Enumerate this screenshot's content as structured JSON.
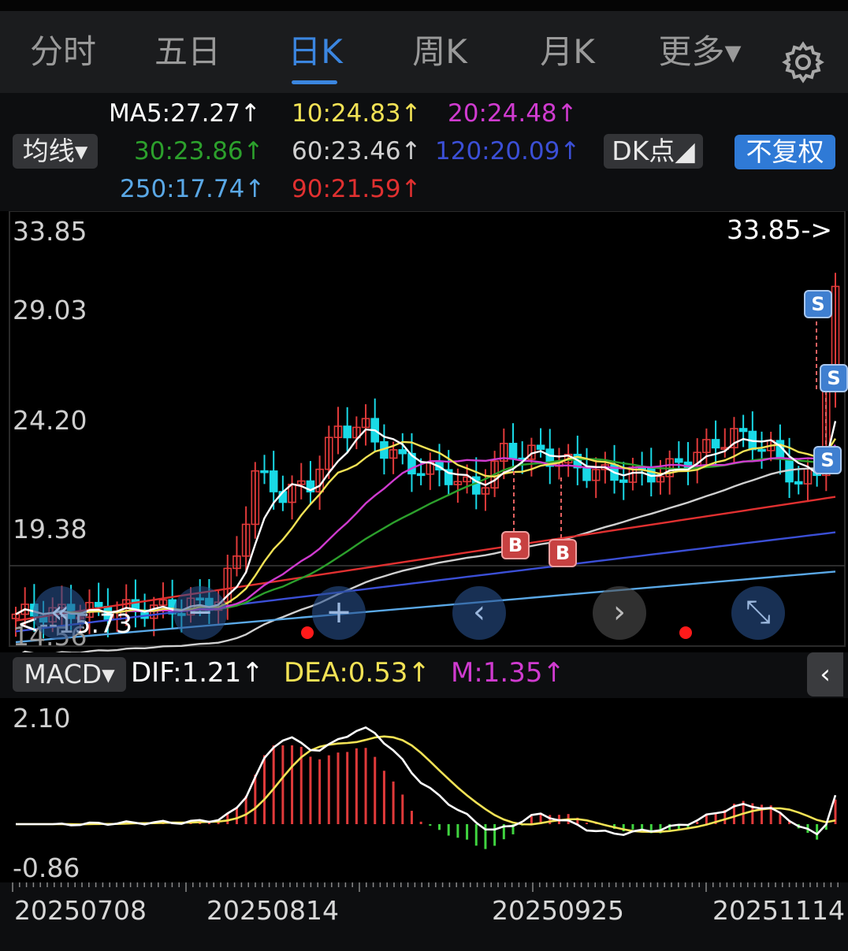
{
  "tabs": [
    {
      "label": "分时",
      "active": false
    },
    {
      "label": "五日",
      "active": false
    },
    {
      "label": "日K",
      "active": true
    },
    {
      "label": "周K",
      "active": false
    },
    {
      "label": "月K",
      "active": false
    },
    {
      "label": "更多▾",
      "active": false
    }
  ],
  "controls": {
    "ma_dropdown": "均线▾",
    "dk_button": "DK点◢",
    "adjust_button": "不复权"
  },
  "ma": [
    {
      "label": "MA5:27.27↑",
      "color": "#ffffff"
    },
    {
      "label": "10:24.83↑",
      "color": "#f2e255"
    },
    {
      "label": "20:24.48↑",
      "color": "#d03bd0"
    },
    {
      "label": "30:23.86↑",
      "color": "#2ca02c"
    },
    {
      "label": "60:23.46↑",
      "color": "#d0d0d0"
    },
    {
      "label": "120:20.09↑",
      "color": "#3b4fd6"
    },
    {
      "label": "250:17.74↑",
      "color": "#5aa8e6"
    },
    {
      "label": "90:21.59↑",
      "color": "#e03030"
    }
  ],
  "price_axis": [
    "33.85",
    "29.03",
    "24.20",
    "19.38",
    "14.56"
  ],
  "high_marker": "33.85->",
  "low_marker": "<--15.73",
  "macd": {
    "selector": "MACD▾",
    "dif": "DIF:1.21↑",
    "dea": "DEA:0.53↑",
    "m": "M:1.35↑",
    "axis_top": "2.10",
    "axis_bottom": "-0.86",
    "collapse": "‹"
  },
  "dates": [
    "20250708",
    "20250814",
    "20250925",
    "20251114"
  ],
  "signals": [
    {
      "label": "S",
      "type": "s"
    },
    {
      "label": "S",
      "type": "s"
    },
    {
      "label": "S",
      "type": "s"
    },
    {
      "label": "B",
      "type": "b"
    },
    {
      "label": "B",
      "type": "b"
    }
  ],
  "nav": {
    "zoom_out": "−",
    "zoom_in": "+",
    "prev": "‹",
    "next": "›",
    "expand": "⤡"
  },
  "colors": {
    "up": "#e03a3a",
    "down": "#19d9e6",
    "accent": "#3b86e0"
  }
}
